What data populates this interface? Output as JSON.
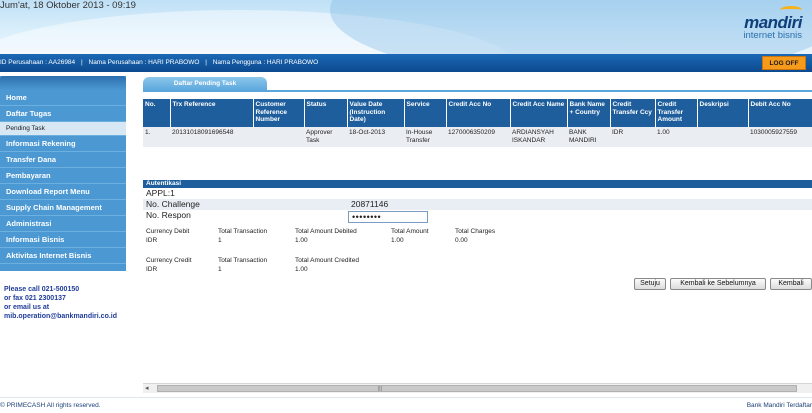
{
  "header": {
    "datetime": "Jum'at, 18 Oktober 2013 - 09:19",
    "brand_name": "mandiri",
    "brand_sub": "internet bisnis",
    "info": {
      "perusahaan_id": "ID Perusahaan : AA26984",
      "sep1": "|",
      "nama_perusahaan": "Nama Perusahaan : HARI PRABOWO",
      "sep2": "|",
      "nama_pengguna": "Nama Pengguna : HARI PRABOWO"
    },
    "logoff_label": "LOG OFF"
  },
  "sidebar": {
    "items": [
      {
        "label": "Home"
      },
      {
        "label": "Daftar Tugas"
      },
      {
        "label": "Pending Task"
      },
      {
        "label": "Informasi Rekening"
      },
      {
        "label": "Transfer Dana"
      },
      {
        "label": "Pembayaran"
      },
      {
        "label": "Download Report Menu"
      },
      {
        "label": "Supply Chain Management"
      },
      {
        "label": "Administrasi"
      },
      {
        "label": "Informasi Bisnis"
      },
      {
        "label": "Aktivitas Internet Bisnis"
      }
    ],
    "contact": {
      "line1": "Please call 021-500150",
      "line2": "or fax 021 2300137",
      "line3": "or email us at",
      "line4": "mib.operation@bankmandiri.co.id"
    }
  },
  "main": {
    "tab_label": "Daftar Pending Task",
    "table": {
      "headers": [
        "No.",
        "Trx Reference",
        "Customer Reference Number",
        "Status",
        "Value Date (Instruction Date)",
        "Service",
        "Credit Acc No",
        "Credit Acc Name",
        "Bank Name + Country",
        "Credit Transfer Ccy",
        "Credit Transfer Amount",
        "Deskripsi",
        "Debit Acc No"
      ],
      "rows": [
        [
          "1.",
          "20131018091696548",
          "",
          "Approver Task",
          "18-Oct-2013",
          "In-House Transfer",
          "1270006350209",
          "ARDIANSYAH ISKANDAR",
          "BANK MANDIRI",
          "IDR",
          "1.00",
          "",
          "1030005927559"
        ]
      ]
    },
    "auth": {
      "title": "Autentikasi",
      "appl": "APPL:1",
      "challenge_label": "No. Challenge",
      "challenge_value": "20871146",
      "respon_label": "No. Respon",
      "respon_value": "••••••••"
    },
    "summary_debit": {
      "currency_label": "Currency Debit",
      "currency_value": "IDR",
      "total_tx_label": "Total Transaction",
      "total_tx_value": "1",
      "total_debited_label": "Total Amount Debited",
      "total_debited_value": "1.00",
      "total_amount_label": "Total Amount",
      "total_amount_value": "1.00",
      "total_charges_label": "Total Charges",
      "total_charges_value": "0.00"
    },
    "summary_credit": {
      "currency_label": "Currency Credit",
      "currency_value": "IDR",
      "total_tx_label": "Total Transaction",
      "total_tx_value": "1",
      "total_credited_label": "Total Amount Credited",
      "total_credited_value": "1.00"
    },
    "buttons": {
      "setuju": "Setuju",
      "kembali_sebelumnya": "Kembali ke Sebelumnya",
      "kembali": "Kembali"
    }
  },
  "footer": {
    "left": "© PRIMECASH All rights reserved.",
    "right": "Bank Mandiri Terdaftar"
  },
  "colors": {
    "header_bar": "#0c4a8e",
    "logoff": "#f59a1b",
    "sidebar": "#4b98d3",
    "table_header": "#1e5e9c"
  }
}
